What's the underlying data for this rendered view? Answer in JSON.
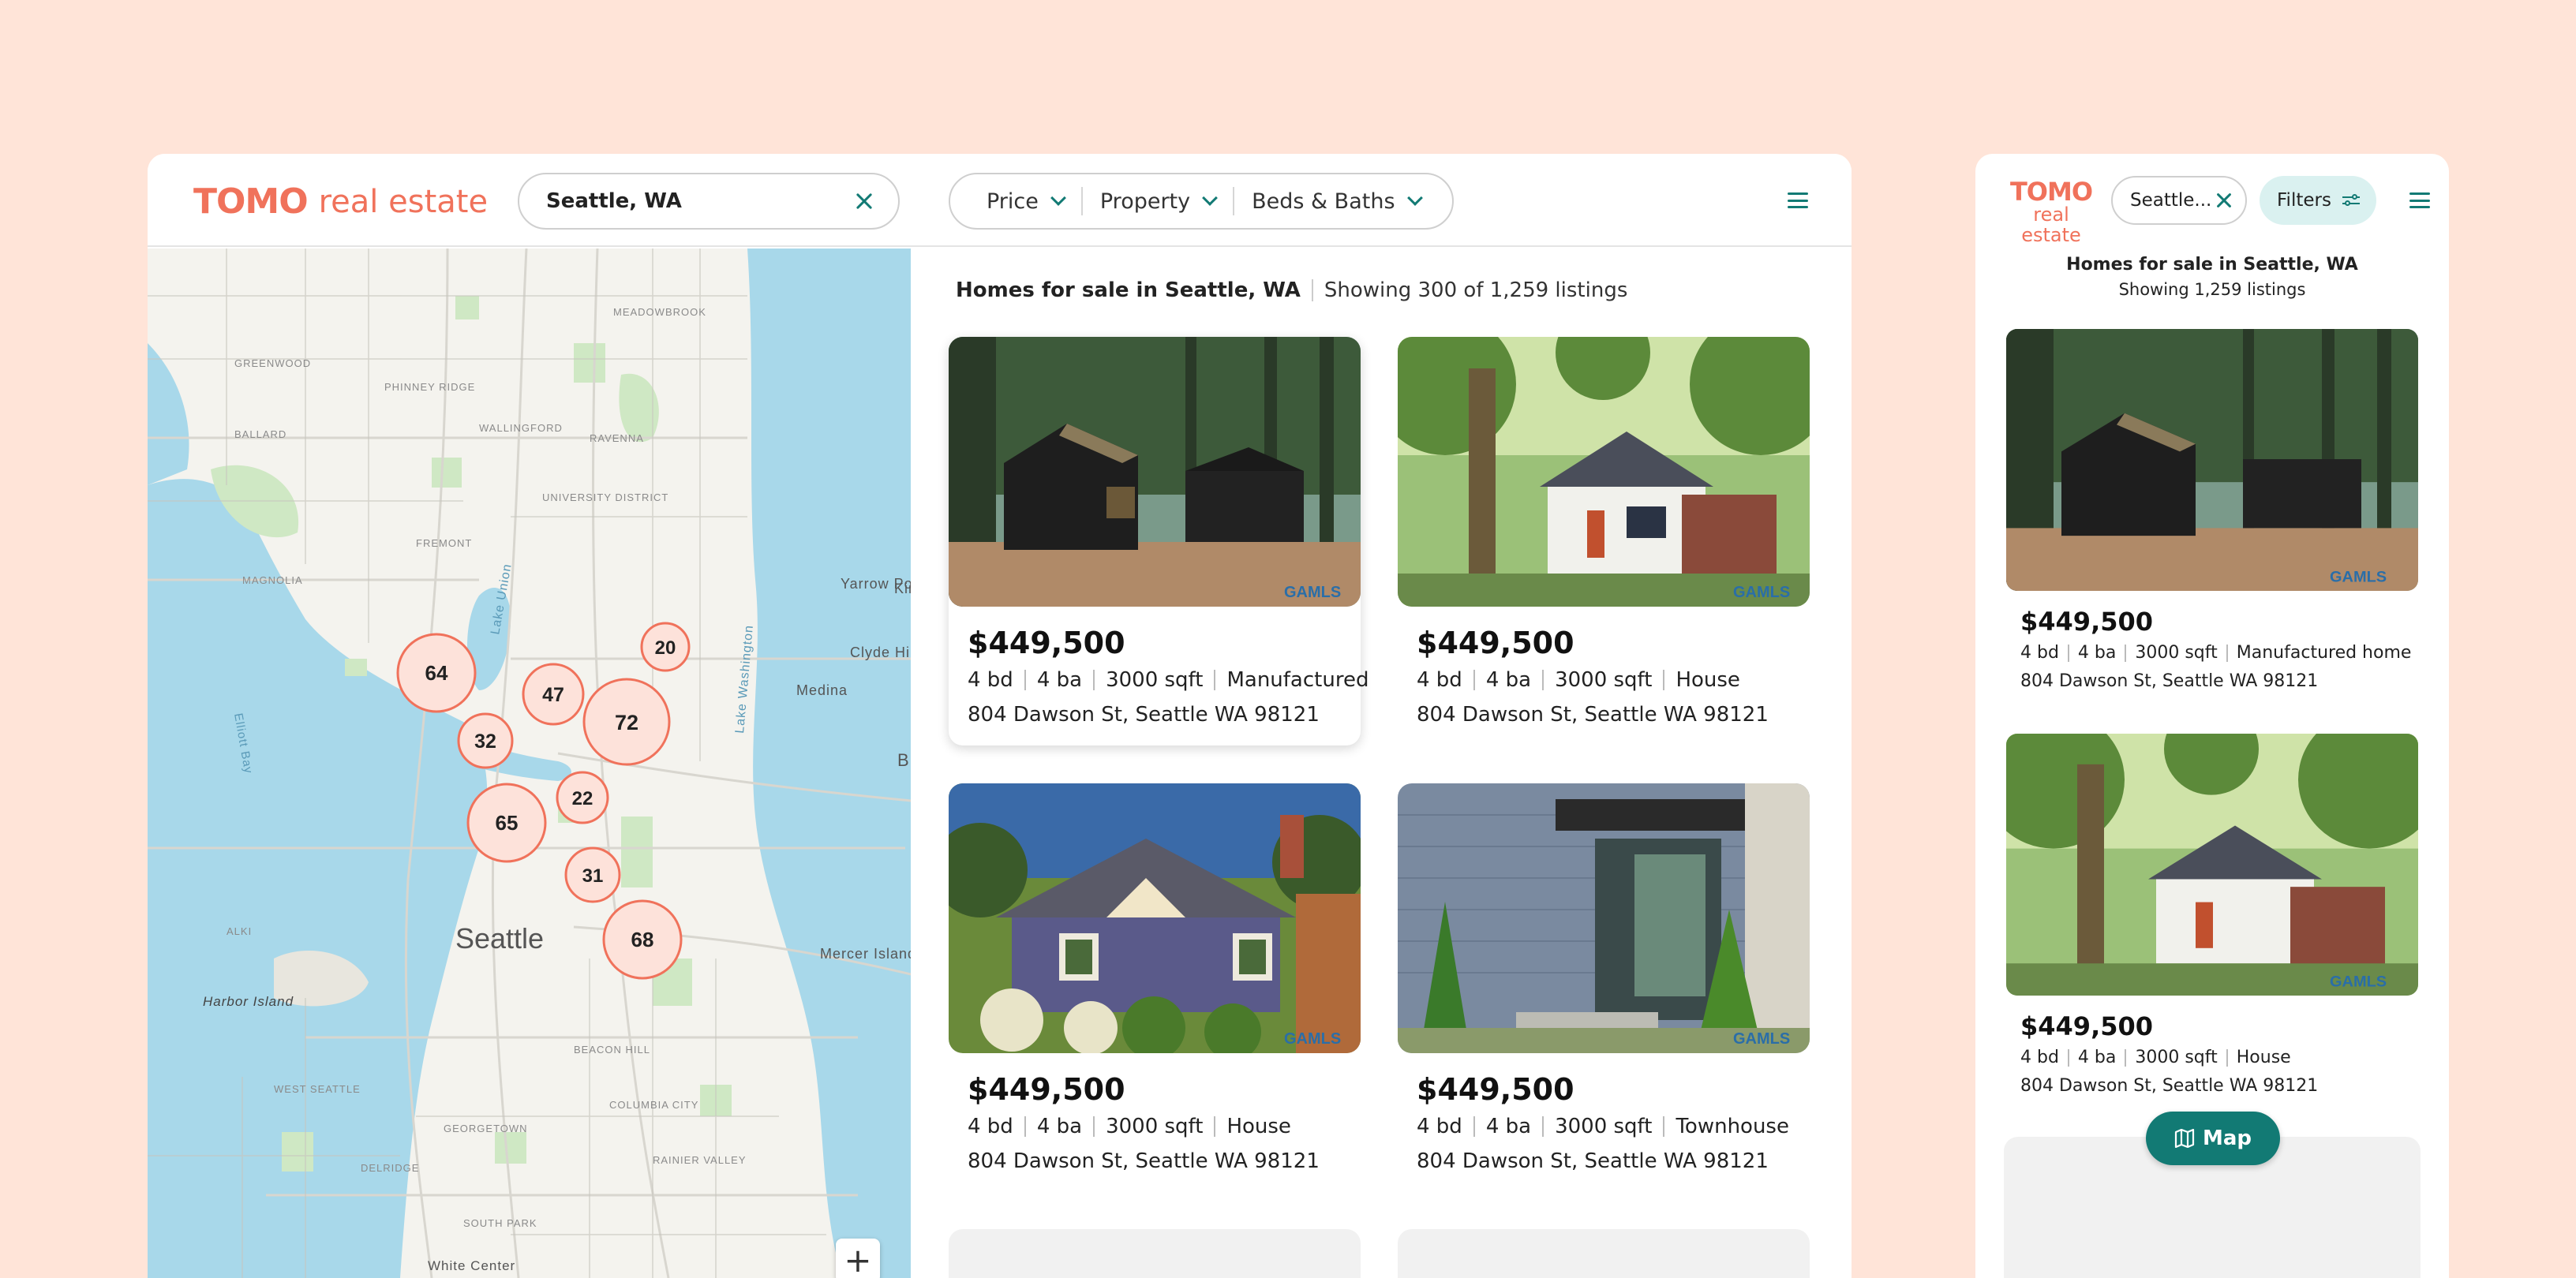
{
  "brand": {
    "mark": "TOMO",
    "word": "real estate",
    "color": "#f0725b",
    "accent": "#127a74"
  },
  "desktop": {
    "search": {
      "value": "Seattle, WA"
    },
    "filters": [
      {
        "label": "Price"
      },
      {
        "label": "Property"
      },
      {
        "label": "Beds & Baths"
      }
    ],
    "results_title": "Homes for sale in Seattle, WA",
    "results_count": "Showing 300 of 1,259 listings",
    "zoom_in_label": "+",
    "listings": [
      {
        "price": "$449,500",
        "beds": "4 bd",
        "baths": "4 ba",
        "sqft": "3000 sqft",
        "type": "Manufactured",
        "address": "804 Dawson St, Seattle WA 98121",
        "photo": "dark-cabin",
        "highlighted": true
      },
      {
        "price": "$449,500",
        "beds": "4 bd",
        "baths": "4 ba",
        "sqft": "3000 sqft",
        "type": "House",
        "address": "804 Dawson St, Seattle WA 98121",
        "photo": "white-bungalow"
      },
      {
        "price": "$449,500",
        "beds": "4 bd",
        "baths": "4 ba",
        "sqft": "3000 sqft",
        "type": "House",
        "address": "804 Dawson St, Seattle WA 98121",
        "photo": "purple-cottage"
      },
      {
        "price": "$449,500",
        "beds": "4 bd",
        "baths": "4 ba",
        "sqft": "3000 sqft",
        "type": "Townhouse",
        "address": "804 Dawson St, Seattle WA 98121",
        "photo": "grey-townhouse"
      }
    ],
    "map": {
      "clusters": [
        "64",
        "32",
        "47",
        "20",
        "72",
        "22",
        "65",
        "31",
        "68"
      ],
      "city_label": "Seattle",
      "place_labels": [
        "GREENWOOD",
        "PHINNEY RIDGE",
        "BALLARD",
        "WALLINGFORD",
        "FREMONT",
        "MAGNOLIA",
        "UNIVERSITY DISTRICT",
        "RAVENNA",
        "MEADOWBROOK",
        "BEACON HILL",
        "Harbor Island",
        "White Center",
        "Mercer Island",
        "Medina",
        "Yarrow Po",
        "Clyde Hil",
        "Lake Washington",
        "Lake Union",
        "Elliott Bay",
        "GEORGETOWN",
        "ALKI",
        "WEST SEATTLE",
        "RAINIER VALLEY",
        "COLUMBIA CITY",
        "SOUTH PARK",
        "DELRIDGE",
        "Kir",
        "B"
      ],
      "water": "#a8d8ea",
      "land": "#f4f3ee",
      "park": "#cfe8c4"
    }
  },
  "mobile": {
    "search": {
      "value": "Seattle..."
    },
    "filters_label": "Filters",
    "title": "Homes for sale in Seattle, WA",
    "subtitle": "Showing 1,259 listings",
    "map_button": "Map",
    "listings": [
      {
        "price": "$449,500",
        "beds": "4 bd",
        "baths": "4 ba",
        "sqft": "3000 sqft",
        "type": "Manufactured home",
        "address": "804 Dawson St, Seattle WA 98121",
        "photo": "dark-cabin"
      },
      {
        "price": "$449,500",
        "beds": "4 bd",
        "baths": "4 ba",
        "sqft": "3000 sqft",
        "type": "House",
        "address": "804 Dawson St, Seattle WA 98121",
        "photo": "white-bungalow"
      }
    ]
  }
}
